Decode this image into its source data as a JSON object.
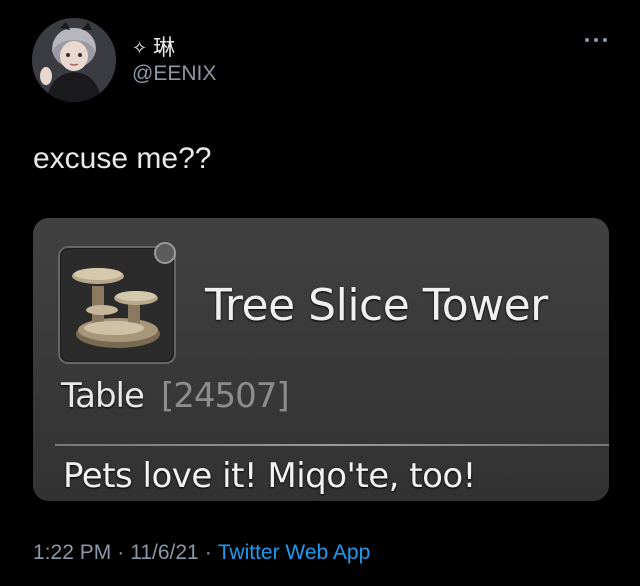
{
  "author": {
    "display_name": "琳",
    "sparkle_glyph": "✧",
    "handle": "@EENIX"
  },
  "tweet": {
    "text": "excuse me??"
  },
  "media": {
    "item_name": "Tree Slice Tower",
    "item_category": "Table",
    "item_id": "[24507]",
    "item_description": "Pets love it! Miqo'te, too!"
  },
  "meta": {
    "time": "1:22 PM",
    "separator": "·",
    "date": "11/6/21",
    "source": "Twitter Web App"
  },
  "colors": {
    "background": "#000000",
    "text_primary": "#e7e9ea",
    "text_secondary": "#8b98a5",
    "link": "#1d9bf0"
  },
  "icons": {
    "more": "more-horizontal-icon",
    "sparkle": "sparkle-icon",
    "item": "tree-slice-tower-icon"
  }
}
